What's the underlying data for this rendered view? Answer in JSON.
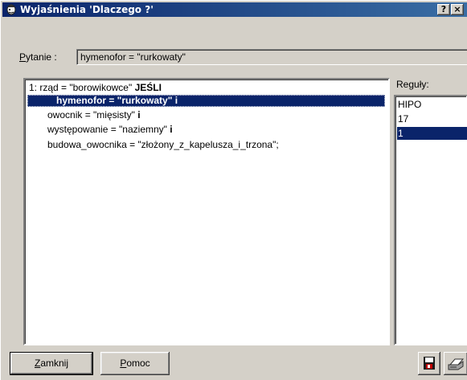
{
  "window": {
    "title": "Wyjaśnienia 'Dlaczego ?'",
    "help_button": "?",
    "close_button": "×"
  },
  "question": {
    "label_underlined": "P",
    "label_rest": "ytanie :",
    "value": "hymenofor = \"rurkowaty\""
  },
  "explanation": {
    "lines": [
      {
        "text": "1: rząd = \"borowikowce\" ",
        "bold": "JEŚLI"
      },
      {
        "text": "hymenofor = \"rurkowaty\" i",
        "bold": ""
      },
      {
        "text": "owocnik = \"mięsisty\" ",
        "bold": "i"
      },
      {
        "text": "występowanie = \"naziemny\" ",
        "bold": "i"
      },
      {
        "text": "budowa_owocnika = \"złożony_z_kapelusza_i_trzona\";",
        "bold": ""
      }
    ],
    "selected_index": 1
  },
  "rules": {
    "label": "Reguły:",
    "items": [
      "HIPO",
      "17",
      "1"
    ],
    "selected_index": 2
  },
  "buttons": {
    "close_underlined": "Z",
    "close_rest": "amknij",
    "help_underlined": "P",
    "help_rest": "omoc"
  },
  "icons": {
    "app": "wizard-head-icon",
    "save": "save-disk-icon",
    "print": "printer-icon"
  },
  "colors": {
    "title_bar": "#0a246a",
    "selection": "#0a246a",
    "face": "#d4d0c8"
  }
}
